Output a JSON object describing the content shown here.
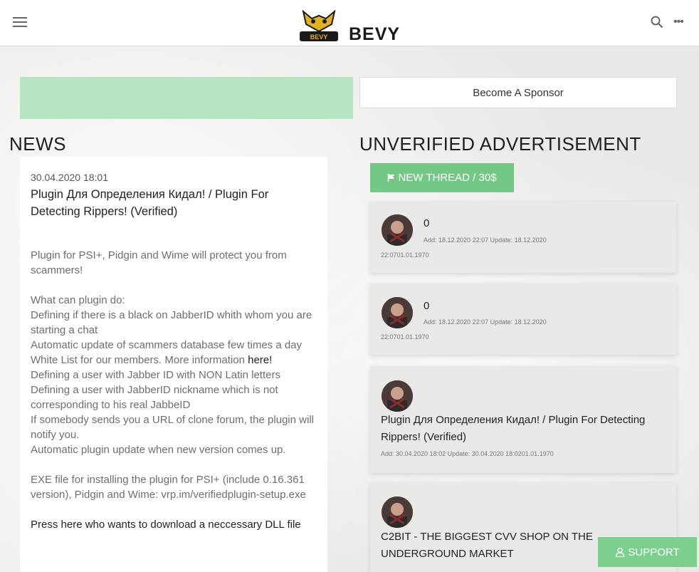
{
  "header": {
    "logo_text": "BEVY",
    "logo_badge_text": "BEVY",
    "more_glyph": "•••"
  },
  "banner": {
    "sponsor_label": "Become A Sponsor"
  },
  "news": {
    "heading": "NEWS",
    "date": "30.04.2020 18:01",
    "title": "Plugin Для Определения Кидал! / Plugin For Detecting Rippers! (Verified)",
    "body": {
      "intro": "Plugin for PSI+, Pidgin and Wime will protect you from scammers!",
      "what_can": "What can plugin do:",
      "item1": "Defining if there is a black on JabberID whith whom you are starting a chat",
      "item2": "Automatic update of scammers database few times a day",
      "item3_prefix": "White List for our members. More information ",
      "item3_link": "here!",
      "item4": "Defining a user with Jabber ID with NON Latin letters",
      "item5": "Defining a user with JabberID nickname which is not corresponding to his real JabbeID",
      "item6": "If somebody sends you a URL of clone forum, the plugin will notify you.",
      "item7": "Automatic plugin update when new version comes up.",
      "exe": "EXE file for installing the plugin for PSI+ (include 0.16.361 version), Pidgin and Wime: vrp.im/verifiedplugin-setup.exe",
      "download": "Press here who wants to download a neccessary DLL file"
    }
  },
  "unverified": {
    "heading": "UNVERIFIED ADVERTISEMENT",
    "new_thread_label": "NEW THREAD / 30$",
    "ads": [
      {
        "count": "0",
        "meta1": "Add: 18.12.2020 22:07 Update: 18.12.2020",
        "meta2": "22:0701.01.1970"
      },
      {
        "count": "0",
        "meta1": "Add: 18.12.2020 22:07 Update: 18.12.2020",
        "meta2": "22:0701.01.1970"
      },
      {
        "title": "Plugin Для Определения Кидал! / Plugin For Detecting Rippers! (Verified)",
        "meta": "Add: 30.04.2020 18:02 Update: 30.04.2020 18:0201.01.1970"
      },
      {
        "title": "C2BIT - THE BIGGEST CVV SHOP ON THE UNDERGROUND MARKET"
      }
    ]
  },
  "support": {
    "label": "SUPPORT"
  },
  "colors": {
    "accent_green": "#74c885",
    "banner_green": "#b5e5c1",
    "support_green": "#7ccf8d"
  }
}
